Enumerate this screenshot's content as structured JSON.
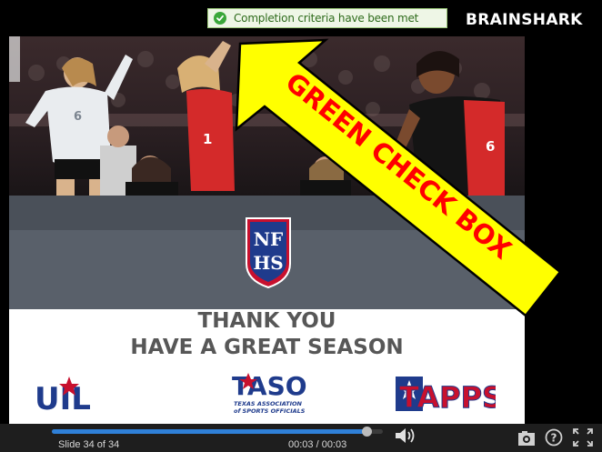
{
  "header": {
    "completion_text": "Completion criteria have been met",
    "brand": "BRAINSHARK"
  },
  "slide": {
    "line1": "THANK YOU",
    "line2": "HAVE A GREAT SEASON",
    "logos": {
      "nfhs": [
        "NF",
        "HS"
      ],
      "uil": "UIL",
      "taso": "TASO",
      "taso_sub1": "TEXAS ASSOCIATION",
      "taso_sub2": "of SPORTS OFFICIALS",
      "tapps": "TAPPS"
    },
    "player_numbers": [
      "6",
      "1",
      "6"
    ]
  },
  "annotation": {
    "label": "GREEN CHECK BOX",
    "color": "#ffff00",
    "text_color": "#ff0000"
  },
  "player": {
    "slide_label": "Slide 34 of 34",
    "time": "00:03 / 00:03",
    "progress": 0.95
  },
  "colors": {
    "accent_blue": "#2f80d8",
    "success_green": "#3aa73a"
  }
}
